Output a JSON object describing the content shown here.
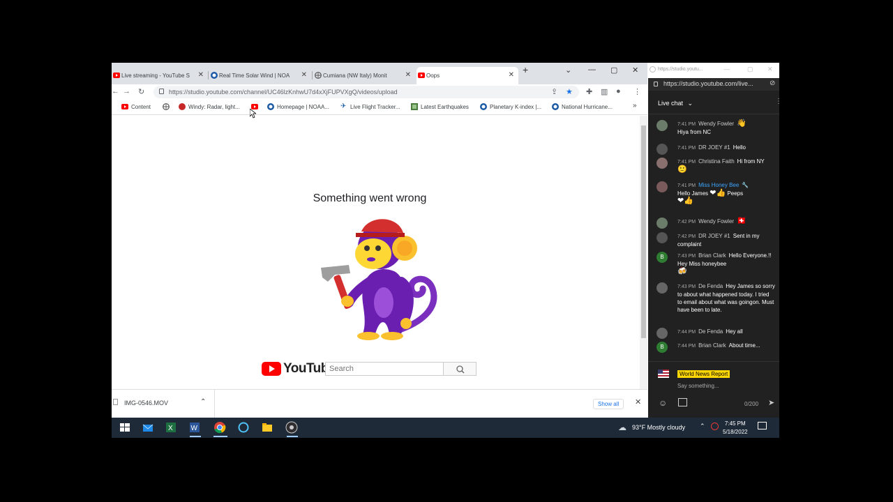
{
  "browser": {
    "tabs": [
      {
        "title": "Live streaming - YouTube S"
      },
      {
        "title": "Real Time Solar Wind | NOA"
      },
      {
        "title": "Cumiana (NW Italy) Monit"
      },
      {
        "title": "Oops"
      }
    ],
    "url": "https://studio.youtube.com/channel/UC46lzKnhwU7d4xXjFUPVXgQ/videos/upload",
    "bookmarks": [
      {
        "label": "Content",
        "icon": "youtube-icon"
      },
      {
        "label": "",
        "icon": "globe-icon"
      },
      {
        "label": "Windy: Radar, light...",
        "icon": "windy-icon"
      },
      {
        "label": "",
        "icon": "youtube-icon"
      },
      {
        "label": "Homepage | NOAA...",
        "icon": "noaa-icon"
      },
      {
        "label": "Live Flight Tracker...",
        "icon": "plane-icon"
      },
      {
        "label": "Latest Earthquakes",
        "icon": "map-icon"
      },
      {
        "label": "Planetary K-index |...",
        "icon": "noaa-icon"
      },
      {
        "label": "National Hurricane...",
        "icon": "noaa-icon"
      }
    ],
    "more_bookmarks": "»"
  },
  "page": {
    "error_title": "Something went wrong",
    "brand": "YouTube",
    "search_placeholder": "Search"
  },
  "downloads": {
    "file": "IMG-0546.MOV",
    "show_all": "Show all"
  },
  "chat": {
    "window_title": "https://studio.youtu...",
    "url": "https://studio.youtube.com/live...",
    "header": "Live chat",
    "messages": [
      {
        "time": "7:41 PM",
        "author": "Wendy Fowler",
        "text": "Hiya from NC",
        "emoji": "👋",
        "avatar_color": "#6b7d6a"
      },
      {
        "time": "7:41 PM",
        "author": "DR JOEY #1",
        "text": "Hello",
        "emoji": "",
        "avatar_color": "#555555"
      },
      {
        "time": "7:41 PM",
        "author": "Christina Faith",
        "text": "Hi from NY",
        "emoji": "🙂",
        "avatar_color": "#8a6f6f"
      },
      {
        "time": "7:41 PM",
        "author": "Miss Honey Bee",
        "text": "Hello James",
        "text2": "Peeps",
        "emoji": "❤👍",
        "emoji2": "❤👍",
        "avatar_color": "#7a5a5a"
      },
      {
        "time": "7:42 PM",
        "author": "Wendy Fowler",
        "text": "",
        "emoji": "🇨🇭",
        "avatar_color": "#6b7d6a"
      },
      {
        "time": "7:42 PM",
        "author": "DR JOEY #1",
        "text": "Sent in my complaint",
        "emoji": "",
        "avatar_color": "#555555"
      },
      {
        "time": "7:43 PM",
        "author": "Brian Clark",
        "text": "Hello Everyone.!! Hey Miss honeybee",
        "emoji": "🍻",
        "avatar_color": "#2e7d32",
        "initial": "B"
      },
      {
        "time": "7:43 PM",
        "author": "De Fenda",
        "text": "Hey James so sorry to about what happened today. I tried to email about what was goingon. Must have been to late.",
        "emoji": "",
        "avatar_color": "#666666"
      },
      {
        "time": "7:44 PM",
        "author": "De Fenda",
        "text": "Hey all",
        "emoji": "",
        "avatar_color": "#666666"
      },
      {
        "time": "7:44 PM",
        "author": "Brian Clark",
        "text": "About time...",
        "emoji": "",
        "avatar_color": "#2e7d32",
        "initial": "B"
      }
    ],
    "input_user": "World News Report",
    "input_placeholder": "Say something...",
    "counter": "0/200"
  },
  "taskbar": {
    "weather": "93°F  Mostly cloudy",
    "time": "7:45 PM",
    "date": "5/18/2022"
  },
  "colors": {
    "youtube_red": "#ff0000",
    "chat_bg": "#212121",
    "taskbar_bg": "#1f2a38",
    "honey_bee_color": "#3ea6ff"
  }
}
